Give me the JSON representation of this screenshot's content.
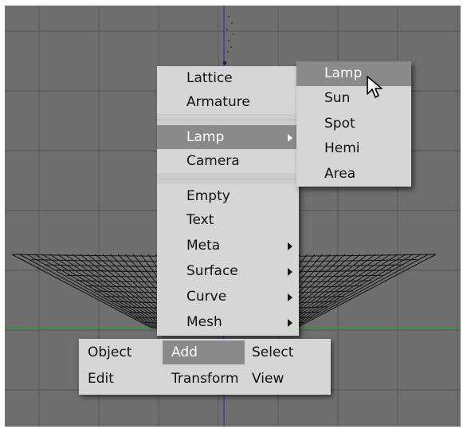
{
  "add_menu": {
    "items": [
      {
        "label": "Lattice"
      },
      {
        "label": "Armature"
      },
      {
        "label": "Lamp",
        "highlighted": true,
        "has_submenu": true
      },
      {
        "label": "Camera"
      },
      {
        "label": "Empty"
      },
      {
        "label": "Text"
      },
      {
        "label": "Meta",
        "has_submenu": true
      },
      {
        "label": "Surface",
        "has_submenu": true
      },
      {
        "label": "Curve",
        "has_submenu": true
      },
      {
        "label": "Mesh",
        "has_submenu": true
      }
    ]
  },
  "lamp_submenu": {
    "items": [
      {
        "label": "Lamp",
        "highlighted": true
      },
      {
        "label": "Sun"
      },
      {
        "label": "Spot"
      },
      {
        "label": "Hemi"
      },
      {
        "label": "Area"
      }
    ]
  },
  "toolbar": {
    "object": "Object",
    "add": "Add",
    "select": "Select",
    "edit": "Edit",
    "transform": "Transform",
    "view": "View"
  },
  "colors": {
    "viewport": "#6f6f6f",
    "grid": "#5a5a5a",
    "menu": "#d6d6d6",
    "highlight": "#8a8a8a",
    "x_axis": "#2f9a2f",
    "z_axis": "#3a3aa0"
  }
}
